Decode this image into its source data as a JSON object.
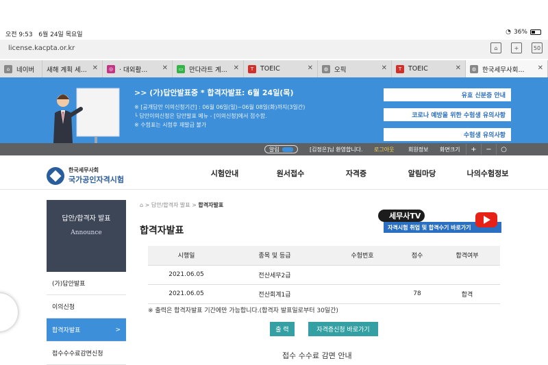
{
  "status": {
    "time": "오전 9:53",
    "date": "6월 24일 목요일",
    "battery": "36%"
  },
  "browser": {
    "url": "license.kacpta.or.kr",
    "tab_count": "50",
    "tabs": [
      {
        "label": "네이버",
        "color": "#888888"
      },
      {
        "label": "새해 계획 세...",
        "color": "#888888"
      },
      {
        "label": "· 대외활...",
        "color": "#c13584"
      },
      {
        "label": "만다라트 계...",
        "color": "#35b34a"
      },
      {
        "label": "TOEIC",
        "color": "#d0302c"
      },
      {
        "label": "오픽",
        "color": "#888888"
      },
      {
        "label": "TOEIC",
        "color": "#d0302c"
      },
      {
        "label": "한국세무사회...",
        "color": "#888888"
      }
    ]
  },
  "banner": {
    "headline": ">> (가)답안발표중 * 합격자발표: 6월 24일(목)",
    "notice1": "※ [공개답안 이의신청기간] : 06월 06일(일)~06월 08일(화)까지(3일간)",
    "notice2": "└ 답안이의신청은 답안발표 메뉴 - [이의신청]에서 접수함.",
    "notice3": "※ 수험표는 시험후 재발급 불가",
    "buttons": [
      "유효 신분증 안내",
      "코로나 예방을 위한 수험생 유의사항",
      "수험생 유의사항"
    ]
  },
  "util": {
    "notice_label": "알림",
    "welcome": "[김정은]님 환영합니다.",
    "logout": "로그아웃",
    "member": "회원정보",
    "screen_size": "화면크기",
    "zoom": [
      "+",
      "−",
      "○"
    ]
  },
  "header": {
    "logo_line1": "한국세무사회",
    "logo_line2": "국가공인자격시험",
    "nav": [
      "시험안내",
      "원서접수",
      "자격증",
      "알림마당",
      "나의수험정보"
    ]
  },
  "sidebar": {
    "title": "답안/합격자 발표",
    "subtitle": "Announce",
    "items": [
      "(가)답안발표",
      "이의신청",
      "합격자발표",
      "접수수수료감면신청"
    ],
    "active_arrow": ">"
  },
  "content": {
    "breadcrumb_path": "> 답안/합격자 발표 > ",
    "breadcrumb_current": "합격자발표",
    "title": "합격자발표",
    "tv_name": "세무사TV",
    "tv_sub": "자격시험 취업 및 합격수기 바로가기",
    "table": {
      "headers": [
        "시행일",
        "종목 및 등급",
        "수험번호",
        "점수",
        "합격여부"
      ],
      "rows": [
        [
          "2021.06.05",
          "전산세무2급",
          "",
          "",
          ""
        ],
        [
          "2021.06.05",
          "전산회계1급",
          "",
          "78",
          "합격"
        ]
      ]
    },
    "print_note": "※ 출력은 합격자발표 기간에만 가능합니다.(합격자 발표일로부터 30일간)",
    "print_button": "출 력",
    "license_button": "자격증신청 바로가기",
    "fee_title": "접수 수수료 감면 안내"
  }
}
